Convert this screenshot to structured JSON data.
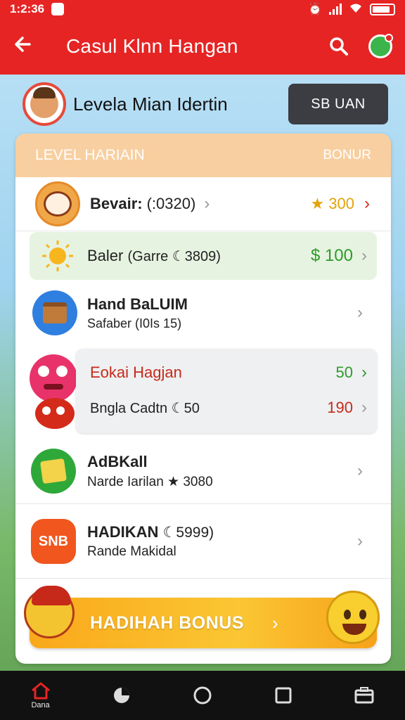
{
  "status_bar": {
    "time": "1:2:36",
    "icons": [
      "notification-icon",
      "alarm-icon",
      "signal-icon",
      "wifi-icon",
      "battery-icon"
    ]
  },
  "app_bar": {
    "title": "Casul Klnn Hangan",
    "back_icon": "arrow-left-icon",
    "search_icon": "search-icon",
    "avatar_icon": "avatar-icon"
  },
  "profile": {
    "name": "Levela Mian Idertin",
    "button_label": "SB UAN"
  },
  "card": {
    "header_left": "LEVEL HARIAIN",
    "header_right": "BONUR",
    "items": [
      {
        "title": "Bevair:",
        "subtitle": "(:0320)",
        "value": "★ 300",
        "icon": "face-icon"
      },
      {
        "title": "Baler",
        "subtitle": "(Garre ☾3809)",
        "value": "$ 100",
        "icon": "sun-icon"
      },
      {
        "title": "Hand BaLUIM",
        "subtitle": "Safaber (I0Is 15)",
        "icon": "box-icon"
      },
      {
        "title": "Eokai Hagjan",
        "subtitle": "Bngla Cadtn ☾50",
        "value_top": "50",
        "value_bottom": "190",
        "icon": "character-icon"
      },
      {
        "title": "AdBKall",
        "subtitle": "Narde Iarilan ★ 3080",
        "icon": "money-icon"
      },
      {
        "title": "HADIKAN",
        "title_extra": "☾5999)",
        "subtitle": "Rande Makidal",
        "icon": "snb-icon",
        "icon_text": "SNB"
      }
    ],
    "bonus_banner": "HADIHAH BONUS"
  },
  "bottom_nav": [
    {
      "label": "Dana",
      "icon": "home-icon"
    },
    {
      "label": "",
      "icon": "pie-icon"
    },
    {
      "label": "",
      "icon": "circle-icon"
    },
    {
      "label": "",
      "icon": "square-icon"
    },
    {
      "label": "",
      "icon": "wallet-icon"
    }
  ],
  "colors": {
    "primary": "#e62424",
    "header_band": "#f8cfa0",
    "gold": "#e4a30a",
    "green": "#2e9b2a"
  }
}
